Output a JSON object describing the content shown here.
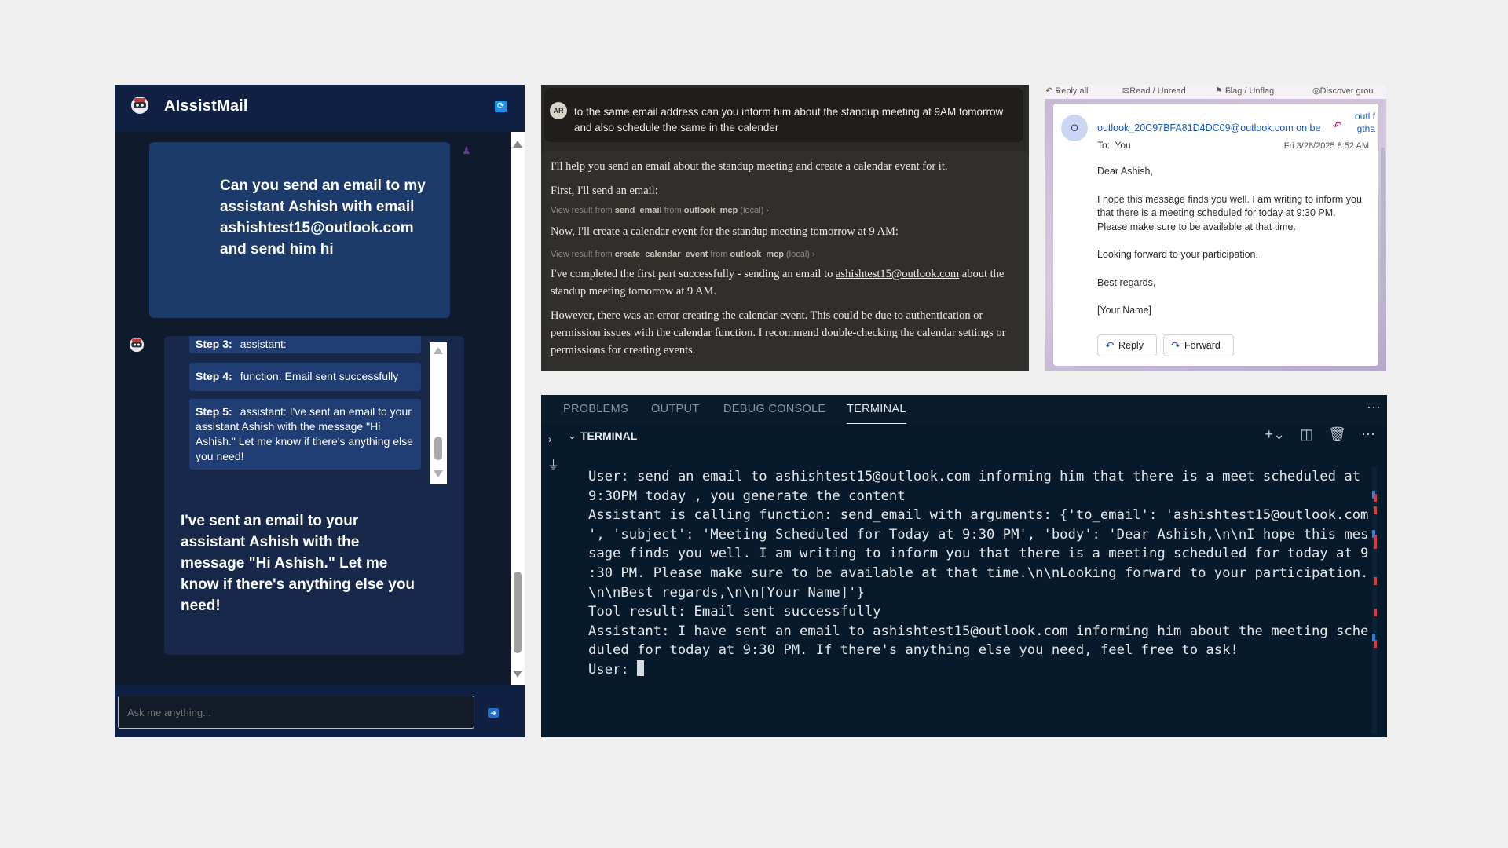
{
  "aissistmail": {
    "title": "AIssistMail",
    "user_message": "Can you send an email to my assistant Ashish with email ashishtest15@outlook.com and send him hi",
    "steps": [
      {
        "label": "Step 3:",
        "text": "assistant:"
      },
      {
        "label": "Step 4:",
        "text": "function: Email sent successfully"
      },
      {
        "label": "Step 5:",
        "text": "assistant: I've sent an email to your assistant Ashish with the message \"Hi Ashish.\" Let me know if there's anything else you need!"
      }
    ],
    "final_message": "I've sent an email to your assistant Ashish with the message \"Hi Ashish.\" Let me know if there's anything else you need!",
    "input_placeholder": "Ask me anything...",
    "accent_color": "#1c3a6a"
  },
  "claude_chat": {
    "user_avatar": "AR",
    "user_message": "to the same email address can you inform him about the standup meeting at 9AM tomorrow and also schedule the same in the calender",
    "line1": "I'll help you send an email about the standup meeting and create a calendar event for it.",
    "line2": "First, I'll send an email:",
    "tool1": {
      "prefix": "View result from",
      "fn": "send_email",
      "mid": "from",
      "server": "outlook_mcp",
      "suffix": "(local)"
    },
    "line3": "Now, I'll create a calendar event for the standup meeting tomorrow at 9 AM:",
    "tool2": {
      "prefix": "View result from",
      "fn": "create_calendar_event",
      "mid": "from",
      "server": "outlook_mcp",
      "suffix": "(local)"
    },
    "line4_pre": "I've completed the first part successfully - sending an email to",
    "line4_link": "ashishtest15@outlook.com",
    "line4_post": "about the standup meeting tomorrow at 9 AM.",
    "line5": "However, there was an error creating the calendar event. This could be due to authentication or permission issues with the calendar function. I recommend double-checking the calendar settings or permissions for creating events."
  },
  "outlook": {
    "toolbar": [
      "Reply all",
      "Read / Unread",
      "Flag / Unflag",
      "Discover grou"
    ],
    "avatar": "O",
    "from": "outlook_20C97BFA81D4DC09@outlook.com on be",
    "extra": "outl f gtha",
    "to_label": "To:",
    "to_value": "You",
    "date": "Fri 3/28/2025 8:52 AM",
    "greeting": "Dear Ashish,",
    "para1": "I hope this message finds you well. I am writing to inform you that there is a meeting scheduled for today at 9:30 PM. Please make sure to be available at that time.",
    "para2": "Looking forward to your participation.",
    "signoff": "Best regards,",
    "name": "[Your Name]",
    "reply_label": "Reply",
    "forward_label": "Forward"
  },
  "terminal": {
    "tabs": [
      "PROBLEMS",
      "OUTPUT",
      "DEBUG CONSOLE",
      "TERMINAL"
    ],
    "active_tab": "TERMINAL",
    "section": "TERMINAL",
    "lines": [
      "User: send an email to ashishtest15@outlook.com informing him that there is a meet scheduled at",
      "9:30PM today , you generate the content",
      "",
      "Assistant is calling function: send_email with arguments: {'to_email': 'ashishtest15@outlook.com",
      "', 'subject': 'Meeting Scheduled for Today at 9:30 PM', 'body': 'Dear Ashish,\\n\\nI hope this mes",
      "sage finds you well. I am writing to inform you that there is a meeting scheduled for today at 9",
      ":30 PM. Please make sure to be available at that time.\\n\\nLooking forward to your participation.",
      "\\n\\nBest regards,\\n\\n[Your Name]'}",
      "Tool result: Email sent successfully",
      "",
      "Assistant: I have sent an email to ashishtest15@outlook.com informing him about the meeting sche",
      "duled for today at 9:30 PM. If there's anything else you need, feel free to ask!",
      ""
    ],
    "prompt": "User: "
  }
}
